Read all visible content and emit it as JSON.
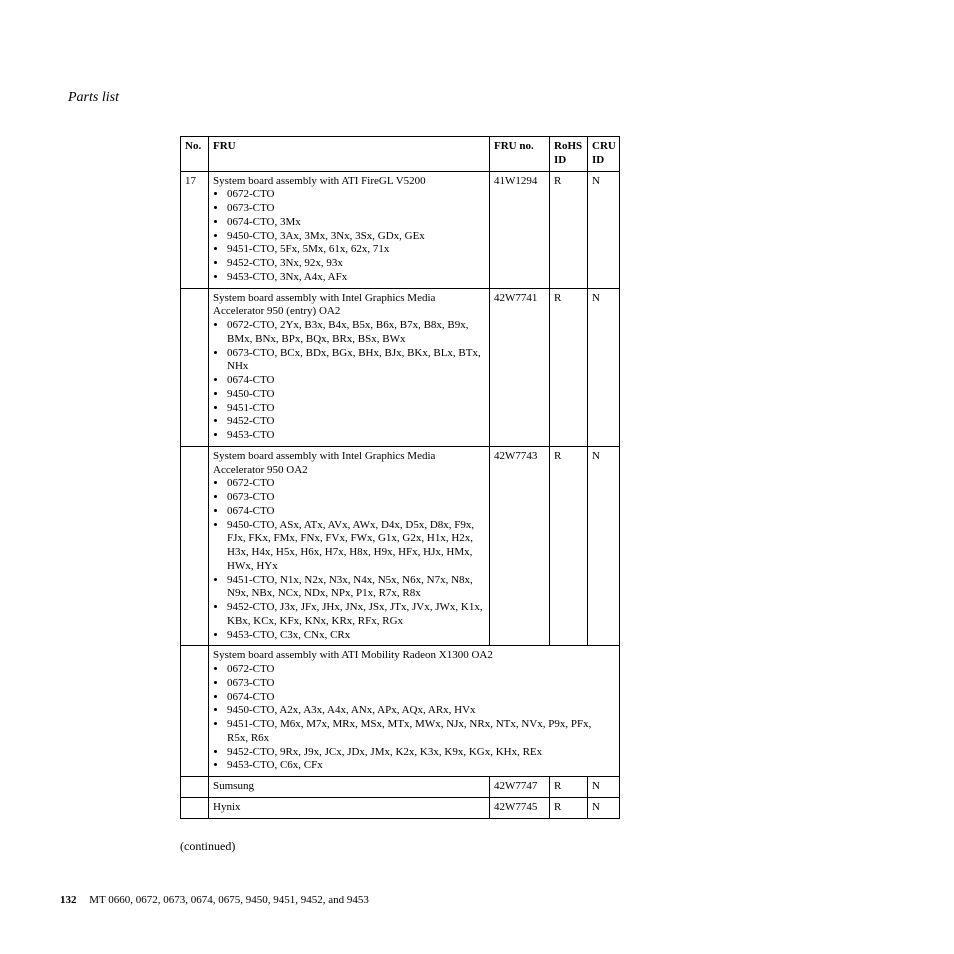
{
  "section_header": "Parts list",
  "table": {
    "headers": {
      "no": "No.",
      "fru": "FRU",
      "fruno": "FRU no.",
      "rohs": "RoHS ID",
      "cru": "CRU ID"
    },
    "rows": [
      {
        "no": "17",
        "title": "System board assembly with ATI FireGL V5200",
        "items": [
          "0672-CTO",
          "0673-CTO",
          "0674-CTO, 3Mx",
          "9450-CTO, 3Ax, 3Mx, 3Nx, 3Sx, GDx, GEx",
          "9451-CTO, 5Fx, 5Mx, 61x, 62x, 71x",
          "9452-CTO, 3Nx, 92x, 93x",
          "9453-CTO, 3Nx, A4x, AFx"
        ],
        "fruno": "41W1294",
        "rohs": "R",
        "cru": "N"
      },
      {
        "no": "",
        "title": "System board assembly with Intel Graphics Media Accelerator 950 (entry) OA2",
        "items": [
          "0672-CTO, 2Yx, B3x, B4x, B5x, B6x, B7x, B8x, B9x, BMx, BNx, BPx, BQx, BRx, BSx, BWx",
          "0673-CTO, BCx, BDx, BGx, BHx, BJx, BKx, BLx, BTx, NHx",
          "0674-CTO",
          "9450-CTO",
          "9451-CTO",
          "9452-CTO",
          "9453-CTO"
        ],
        "fruno": "42W7741",
        "rohs": "R",
        "cru": "N"
      },
      {
        "no": "",
        "title": "System board assembly with Intel Graphics Media Accelerator 950 OA2",
        "items": [
          "0672-CTO",
          "0673-CTO",
          "0674-CTO",
          "9450-CTO, ASx, ATx, AVx, AWx, D4x, D5x, D8x, F9x, FJx, FKx, FMx, FNx, FVx, FWx, G1x, G2x, H1x, H2x, H3x, H4x, H5x, H6x, H7x, H8x, H9x, HFx, HJx, HMx, HWx, HYx",
          "9451-CTO, N1x, N2x, N3x, N4x, N5x, N6x, N7x, N8x, N9x, NBx, NCx, NDx, NPx, P1x, R7x, R8x",
          "9452-CTO, J3x, JFx, JHx, JNx, JSx, JTx, JVx, JWx, K1x, KBx, KCx, KFx, KNx, KRx, RFx, RGx",
          "9453-CTO, C3x, CNx, CRx"
        ],
        "fruno": "42W7743",
        "rohs": "R",
        "cru": "N"
      }
    ],
    "span_row": {
      "title": "System board assembly with ATI Mobility Radeon X1300 OA2",
      "items": [
        "0672-CTO",
        "0673-CTO",
        "0674-CTO",
        "9450-CTO, A2x, A3x, A4x, ANx, APx, AQx, ARx, HVx",
        "9451-CTO, M6x, M7x, MRx, MSx, MTx, MWx, NJx, NRx, NTx, NVx, P9x, PFx, R5x, R6x",
        "9452-CTO, 9Rx, J9x, JCx, JDx, JMx, K2x, K3x, K9x, KGx, KHx, REx",
        "9453-CTO, C6x, CFx"
      ]
    },
    "sub_rows": [
      {
        "label": "Sumsung",
        "fruno": "42W7747",
        "rohs": "R",
        "cru": "N"
      },
      {
        "label": "Hynix",
        "fruno": "42W7745",
        "rohs": "R",
        "cru": "N"
      }
    ]
  },
  "continued": "(continued)",
  "footer": {
    "page": "132",
    "text": "MT 0660, 0672, 0673, 0674, 0675, 9450, 9451, 9452, and 9453"
  }
}
